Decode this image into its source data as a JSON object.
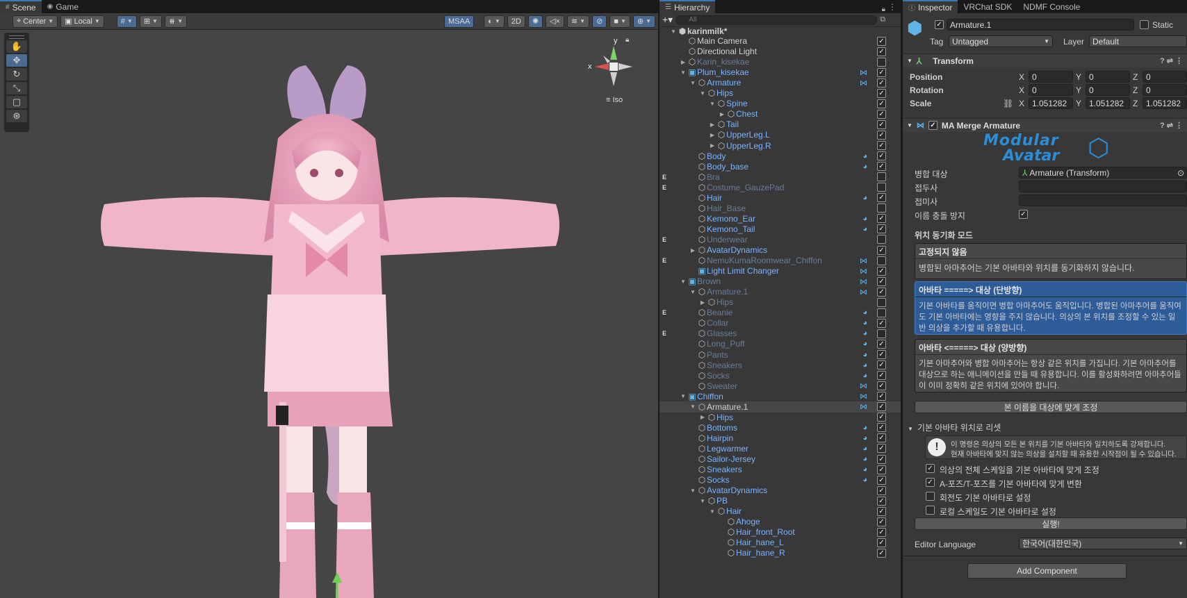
{
  "scene_tabs": {
    "scene": "Scene",
    "game": "Game"
  },
  "scene_toolbar": {
    "pivot": "Center",
    "space": "Local",
    "msaa": "MSAA",
    "mode2d": "2D"
  },
  "gizmo": {
    "x": "x",
    "y": "y",
    "view": "Iso"
  },
  "hierarchy": {
    "tab": "Hierarchy",
    "search_placeholder": "All",
    "rows": [
      {
        "name": "karinmilk*",
        "style": "root"
      },
      {
        "name": "Main Camera",
        "style": "normal"
      },
      {
        "name": "Directional Light",
        "style": "normal"
      },
      {
        "name": "Karin_kisekae",
        "style": "dim"
      },
      {
        "name": "Plum_kisekae",
        "style": "pref"
      },
      {
        "name": "Armature",
        "style": "pref"
      },
      {
        "name": "Hips",
        "style": "pref"
      },
      {
        "name": "Spine",
        "style": "pref"
      },
      {
        "name": "Chest",
        "style": "pref"
      },
      {
        "name": "Tail",
        "style": "pref"
      },
      {
        "name": "UpperLeg.L",
        "style": "pref"
      },
      {
        "name": "UpperLeg.R",
        "style": "pref"
      },
      {
        "name": "Body",
        "style": "pref"
      },
      {
        "name": "Body_base",
        "style": "pref"
      },
      {
        "name": "Bra",
        "style": "dim",
        "flag": "E"
      },
      {
        "name": "Costume_GauzePad",
        "style": "dim",
        "flag": "E"
      },
      {
        "name": "Hair",
        "style": "pref"
      },
      {
        "name": "Hair_Base",
        "style": "dim"
      },
      {
        "name": "Kemono_Ear",
        "style": "pref"
      },
      {
        "name": "Kemono_Tail",
        "style": "pref"
      },
      {
        "name": "Underwear",
        "style": "dim",
        "flag": "E"
      },
      {
        "name": "AvatarDynamics",
        "style": "pref"
      },
      {
        "name": "NemuKumaRoomwear_Chiffon",
        "style": "dim",
        "flag": "E"
      },
      {
        "name": "Light Limit Changer",
        "style": "pref"
      },
      {
        "name": "Brown",
        "style": "dim"
      },
      {
        "name": "Armature.1",
        "style": "dim"
      },
      {
        "name": "Hips",
        "style": "dim"
      },
      {
        "name": "Beanie",
        "style": "dim",
        "flag": "E"
      },
      {
        "name": "Collar",
        "style": "dim"
      },
      {
        "name": "Glasses",
        "style": "dim",
        "flag": "E"
      },
      {
        "name": "Long_Puff",
        "style": "dim"
      },
      {
        "name": "Pants",
        "style": "dim"
      },
      {
        "name": "Sneakers",
        "style": "dim"
      },
      {
        "name": "Socks",
        "style": "dim"
      },
      {
        "name": "Sweater",
        "style": "dim"
      },
      {
        "name": "Chiffon",
        "style": "pref"
      },
      {
        "name": "Armature.1",
        "style": "normal"
      },
      {
        "name": "Hips",
        "style": "pref"
      },
      {
        "name": "Bottoms",
        "style": "pref"
      },
      {
        "name": "Hairpin",
        "style": "pref"
      },
      {
        "name": "Legwarmer",
        "style": "pref"
      },
      {
        "name": "Sailor-Jersey",
        "style": "pref"
      },
      {
        "name": "Sneakers",
        "style": "pref"
      },
      {
        "name": "Socks",
        "style": "pref"
      },
      {
        "name": "AvatarDynamics",
        "style": "pref"
      },
      {
        "name": "PB",
        "style": "pref"
      },
      {
        "name": "Hair",
        "style": "pref"
      },
      {
        "name": "Ahoge",
        "style": "pref"
      },
      {
        "name": "Hair_front_Root",
        "style": "pref"
      },
      {
        "name": "Hair_hane_L",
        "style": "pref"
      },
      {
        "name": "Hair_hane_R",
        "style": "pref"
      }
    ]
  },
  "inspector": {
    "tabs": [
      "Inspector",
      "VRChat SDK",
      "NDMF Console"
    ],
    "object_name": "Armature.1",
    "static_label": "Static",
    "tag_label": "Tag",
    "tag_value": "Untagged",
    "layer_label": "Layer",
    "layer_value": "Default",
    "transform": {
      "title": "Transform",
      "position_label": "Position",
      "rotation_label": "Rotation",
      "scale_label": "Scale",
      "position": [
        "0",
        "0",
        "0"
      ],
      "rotation": [
        "0",
        "0",
        "0"
      ],
      "scale": [
        "1.051282",
        "1.051282",
        "1.051282"
      ]
    },
    "merge": {
      "title": "MA Merge Armature",
      "logo_line1": "Modular",
      "logo_line2": "Avatar",
      "target_label": "병합 대상",
      "target_value": "Armature (Transform)",
      "prefix_label": "접두사",
      "suffix_label": "접미사",
      "avoid_label": "이름 충돌 방지",
      "sync_mode_label": "위치 동기화 모드",
      "modes": [
        {
          "title": "고정되지 않음",
          "desc": "병합된 아마추어는 기본 아바타와 위치를 동기화하지 않습니다."
        },
        {
          "title": "아바타 =====> 대상 (단방향)",
          "desc": "기본 아바타를 움직이면 병합 아마추어도 움직입니다. 병합된 아마추어를 움직여도 기본 아바타에는 영향을 주지 않습니다. 의상의 본 위치를 조정할 수 있는 일반 의상을 추가할 때 유용합니다."
        },
        {
          "title": "아바타 <=====> 대상 (양방향)",
          "desc": "기본 아마추어와 병합 아마추어는 항상 같은 위치를 가집니다. 기본 아마추어를 대상으로 하는 애니메이션을 만들 때 유용합니다. 이를 활성화하려면 아마추어들이 이미 정확히 같은 위치에 있어야 합니다."
        }
      ],
      "adjust_button": "본 이름을 대상에 맞게 조정",
      "reset_section": "기본 아바타 위치로 리셋",
      "warning_line1": "이 명령은 의상의 모든 본 위치를 기본 아바타와 일치하도록 강제합니다.",
      "warning_line2": "현재 아바타에 맞지 않는 의상을 설치할 때 유용한 시작점이 될 수 있습니다.",
      "options": [
        {
          "label": "의상의 전체 스케일을 기본 아바타에 맞게 조정",
          "checked": true
        },
        {
          "label": "A-포즈/T-포즈를 기본 아바타에 맞게 변환",
          "checked": true
        },
        {
          "label": "회전도 기본 아바타로 설정",
          "checked": false
        },
        {
          "label": "로컬 스케일도 기본 아바타로 설정",
          "checked": false
        }
      ],
      "run_button": "실행!",
      "editor_language_label": "Editor Language",
      "editor_language_value": "한국어(대한민국)"
    },
    "add_component": "Add Component"
  }
}
